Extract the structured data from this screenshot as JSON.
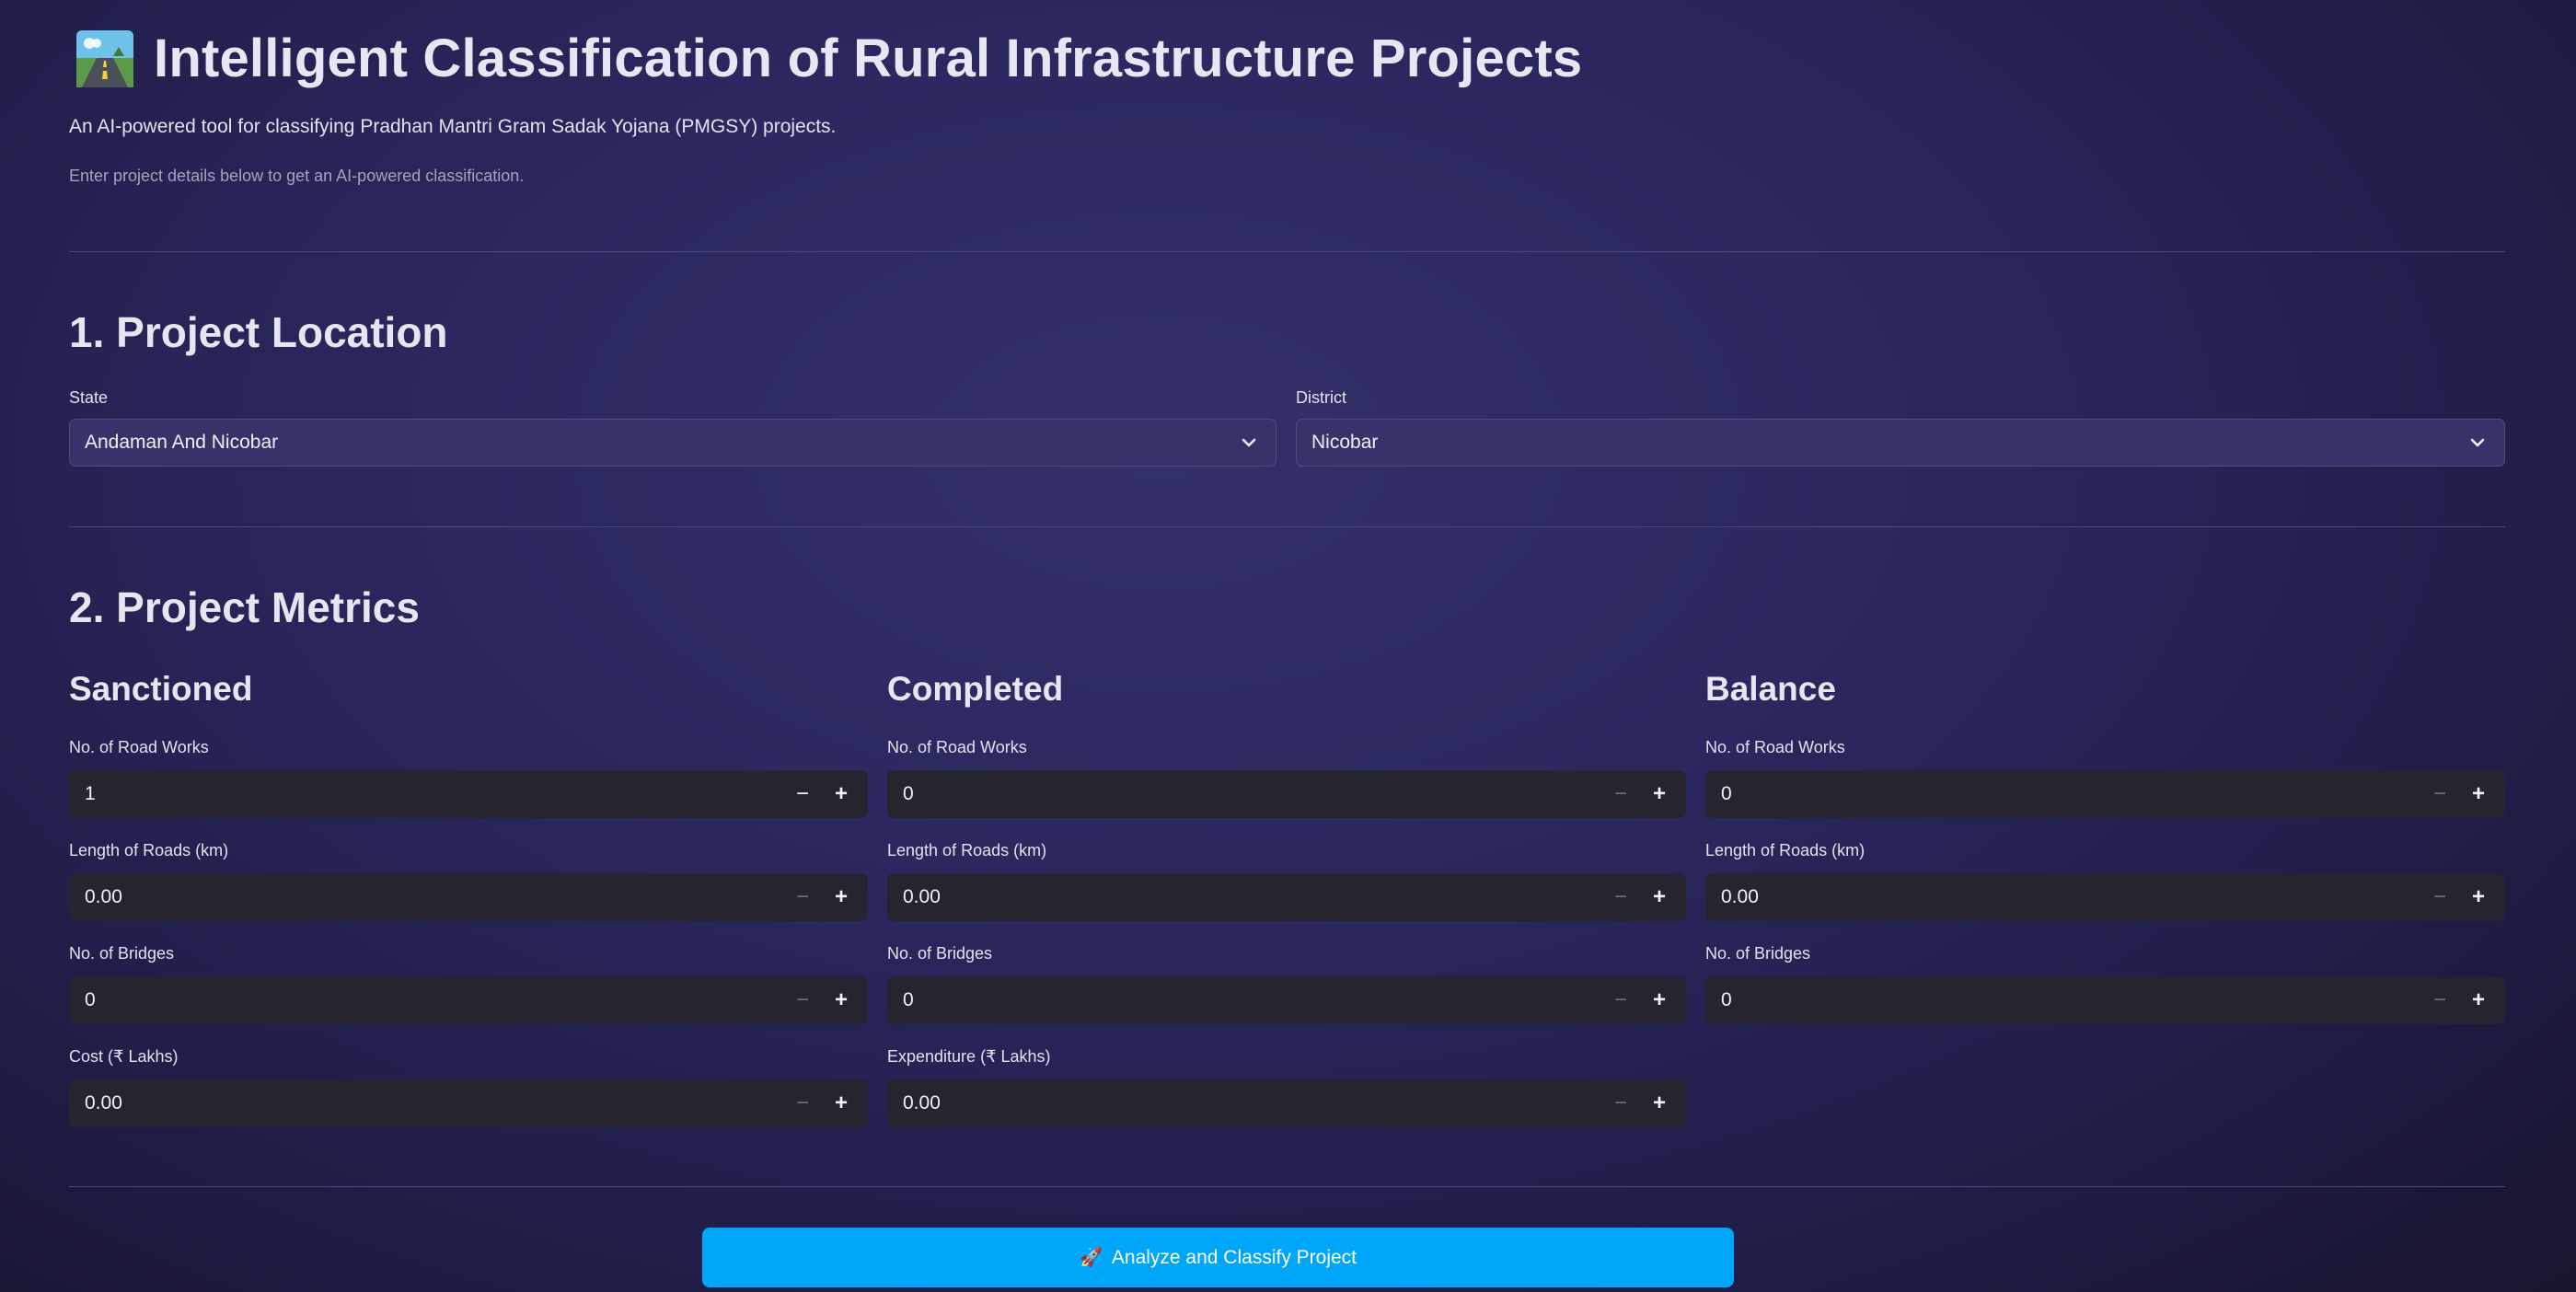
{
  "header": {
    "title": "Intelligent Classification of Rural Infrastructure Projects",
    "subtitle": "An AI-powered tool for classifying Pradhan Mantri Gram Sadak Yojana (PMGSY) projects.",
    "hint": "Enter project details below to get an AI-powered classification."
  },
  "location": {
    "heading": "1. Project Location",
    "state_label": "State",
    "state_value": "Andaman And Nicobar",
    "district_label": "District",
    "district_value": "Nicobar"
  },
  "metrics": {
    "heading": "2. Project Metrics",
    "sanctioned": {
      "heading": "Sanctioned",
      "road_works_label": "No. of Road Works",
      "road_works": "1",
      "length_label": "Length of Roads (km)",
      "length": "0.00",
      "bridges_label": "No. of Bridges",
      "bridges": "0",
      "cost_label": "Cost (₹ Lakhs)",
      "cost": "0.00"
    },
    "completed": {
      "heading": "Completed",
      "road_works_label": "No. of Road Works",
      "road_works": "0",
      "length_label": "Length of Roads (km)",
      "length": "0.00",
      "bridges_label": "No. of Bridges",
      "bridges": "0",
      "expenditure_label": "Expenditure (₹ Lakhs)",
      "expenditure": "0.00"
    },
    "balance": {
      "heading": "Balance",
      "road_works_label": "No. of Road Works",
      "road_works": "0",
      "length_label": "Length of Roads (km)",
      "length": "0.00",
      "bridges_label": "No. of Bridges",
      "bridges": "0"
    }
  },
  "stepper": {
    "minus": "−",
    "plus": "+"
  },
  "cta": {
    "icon": "🚀",
    "label": "Analyze and Classify Project"
  },
  "colors": {
    "accent": "#00a6f7",
    "input_bg": "#25242f",
    "select_bg": "#35336a"
  },
  "icons": {
    "title": "road-icon",
    "select": "chevron-down-icon",
    "cta": "rocket-icon"
  }
}
